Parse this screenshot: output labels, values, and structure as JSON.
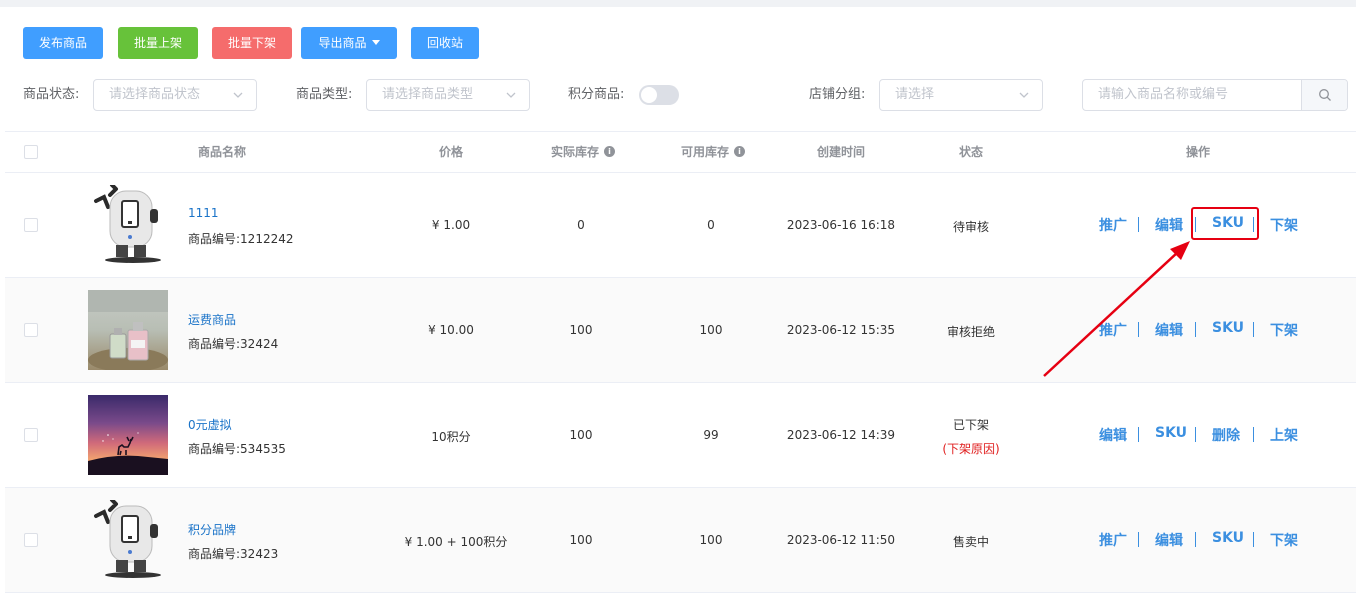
{
  "toolbar": {
    "publish": "发布商品",
    "batch_on": "批量上架",
    "batch_off": "批量下架",
    "export": "导出商品",
    "recycle": "回收站"
  },
  "filters": {
    "status_label": "商品状态:",
    "status_placeholder": "请选择商品状态",
    "type_label": "商品类型:",
    "type_placeholder": "请选择商品类型",
    "points_label": "积分商品:",
    "points_toggle": false,
    "group_label": "店铺分组:",
    "group_placeholder": "请选择",
    "search_placeholder": "请输入商品名称或编号"
  },
  "table": {
    "headers": {
      "name": "商品名称",
      "price": "价格",
      "real_stock": "实际库存",
      "available_stock": "可用库存",
      "created": "创建时间",
      "status": "状态",
      "actions": "操作"
    },
    "rows": [
      {
        "name": "1111",
        "code": "商品编号:1212242",
        "price": "¥ 1.00",
        "real_stock": "0",
        "available_stock": "0",
        "created": "2023-06-16 16:18",
        "status": "待审核",
        "status_note": "",
        "image": "robot",
        "actions": [
          "推广",
          "编辑",
          "SKU",
          "下架"
        ]
      },
      {
        "name": "运费商品",
        "code": "商品编号:32424",
        "price": "¥ 10.00",
        "real_stock": "100",
        "available_stock": "100",
        "created": "2023-06-12 15:35",
        "status": "审核拒绝",
        "status_note": "",
        "image": "perfume",
        "actions": [
          "推广",
          "编辑",
          "SKU",
          "下架"
        ]
      },
      {
        "name": "0元虚拟",
        "code": "商品编号:534535",
        "price": "10积分",
        "real_stock": "100",
        "available_stock": "99",
        "created": "2023-06-12 14:39",
        "status": "已下架",
        "status_note": "(下架原因)",
        "image": "sunset-deer",
        "actions": [
          "编辑",
          "SKU",
          "删除",
          "上架"
        ]
      },
      {
        "name": "积分品牌",
        "code": "商品编号:32423",
        "price": "¥ 1.00 + 100积分",
        "real_stock": "100",
        "available_stock": "100",
        "created": "2023-06-12 11:50",
        "status": "售卖中",
        "status_note": "",
        "image": "robot",
        "actions": [
          "推广",
          "编辑",
          "SKU",
          "下架"
        ]
      }
    ]
  },
  "annotation": {
    "highlight_target": "SKU",
    "highlight_color": "#e60012"
  },
  "colors": {
    "primary": "#409eff",
    "success": "#67c23a",
    "danger": "#f56c6c",
    "link": "#3b8fe0"
  },
  "icons": {
    "info": "info-icon",
    "search": "search-icon",
    "dropdown": "chevron-down-icon"
  }
}
